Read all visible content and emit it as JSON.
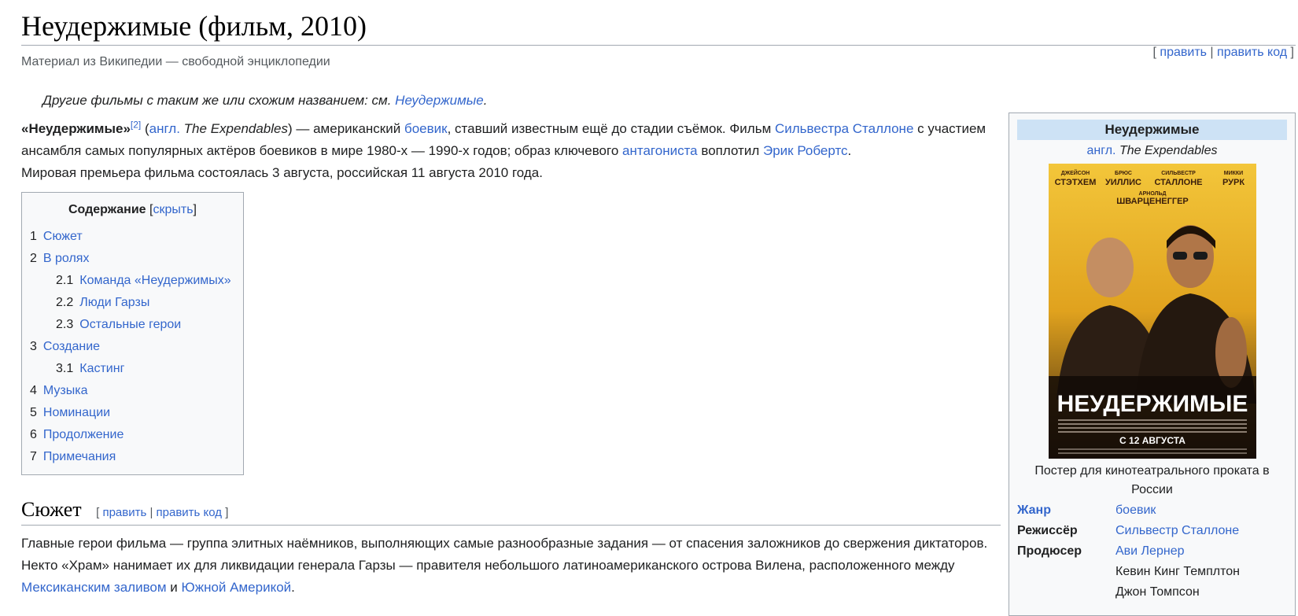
{
  "article": {
    "title": "Неудержимые (фильм, 2010)",
    "subtitle": "Материал из Википедии — свободной энциклопедии",
    "edit_label": "править",
    "edit_code_label": "править код"
  },
  "hatnote": {
    "text": "Другие фильмы с таким же или схожим названием: см. ",
    "link": "Неудержимые",
    "end": "."
  },
  "intro": {
    "bold": "«Неудержимые»",
    "ref": "[2]",
    "t1": " (",
    "lang_link": "англ.",
    "orig_title": " The Expendables",
    "t2": ") — американский ",
    "genre_link": "боевик",
    "t3": ", ставший известным ещё до стадии съёмок. Фильм ",
    "director_link": "Сильвестра Сталлоне",
    "t4": " с участием ансамбля самых популярных актёров боевиков в мире 1980-х — 1990-х годов; образ ключевого ",
    "antagonist_link": "антагониста",
    "t5": " воплотил ",
    "roberts_link": "Эрик Робертс",
    "t6": ".",
    "line3": "Мировая премьера фильма состоялась 3 августа, российская 11 августа 2010 года."
  },
  "toc": {
    "title": "Содержание",
    "toggle": "скрыть",
    "items": [
      {
        "num": "1",
        "label": "Сюжет",
        "level": 1
      },
      {
        "num": "2",
        "label": "В ролях",
        "level": 1
      },
      {
        "num": "2.1",
        "label": "Команда «Неудержимых»",
        "level": 2
      },
      {
        "num": "2.2",
        "label": "Люди Гарзы",
        "level": 2
      },
      {
        "num": "2.3",
        "label": "Остальные герои",
        "level": 2
      },
      {
        "num": "3",
        "label": "Создание",
        "level": 1
      },
      {
        "num": "3.1",
        "label": "Кастинг",
        "level": 2
      },
      {
        "num": "4",
        "label": "Музыка",
        "level": 1
      },
      {
        "num": "5",
        "label": "Номинации",
        "level": 1
      },
      {
        "num": "6",
        "label": "Продолжение",
        "level": 1
      },
      {
        "num": "7",
        "label": "Примечания",
        "level": 1
      }
    ]
  },
  "plot_section": {
    "heading": "Сюжет",
    "edit_label": "править",
    "edit_code_label": "править код",
    "p1": "Главные герои фильма — группа элитных наёмников, выполняющих самые разнообразные задания — от спасения заложников до свержения диктаторов. Некто «Храм» нанимает их для ликвидации генерала Гарзы — правителя небольшого латиноамериканского острова Вилена, расположенного между ",
    "gulf_link": "Мексиканским заливом",
    "and": " и ",
    "sa_link": "Южной Америкой",
    "end": "."
  },
  "infobox": {
    "title": "Неудержимые",
    "lang_link": "англ.",
    "orig_title": " The Expendables",
    "poster": {
      "names_top": [
        "ДЖЕЙСОН",
        "БРЮС",
        "СИЛЬВЕСТР",
        "МИККИ"
      ],
      "surnames_top": [
        "СТЭТХЕМ",
        "УИЛЛИС",
        "СТАЛЛОНЕ",
        "РУРК"
      ],
      "arnold_first": "АРНОЛЬД",
      "arnold_last": "ШВАРЦЕНЕГГЕР",
      "main_title": "НЕУДЕРЖИМЫЕ",
      "release": "С 12 АВГУСТА"
    },
    "caption": "Постер для кинотеатрального проката в России",
    "rows": [
      {
        "label": "Жанр",
        "value": "боевик",
        "label_link": true,
        "value_link": true
      },
      {
        "label": "Режиссёр",
        "value": "Сильвестр Сталлоне",
        "label_link": false,
        "value_link": true
      },
      {
        "label": "Продюсер",
        "value": "Ави Лернер",
        "label_link": false,
        "value_link": true
      },
      {
        "label": "",
        "value": "Кевин Кинг Темплтон",
        "label_link": false,
        "value_link": false
      },
      {
        "label": "",
        "value": "Джон Томпсон",
        "label_link": false,
        "value_link": false
      }
    ]
  },
  "colors": {
    "link": "#3366cc",
    "text": "#202122",
    "infobox_header": "#cde2f5",
    "poster_bg": "#f0b82a"
  }
}
